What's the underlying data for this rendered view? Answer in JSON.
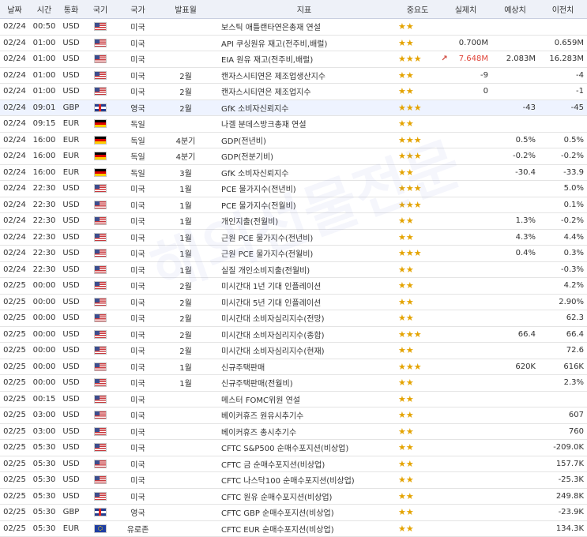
{
  "headers": [
    "날짜",
    "시간",
    "통화",
    "국기",
    "국가",
    "발표월",
    "지표",
    "중요도",
    "실제치",
    "예상치",
    "이전치"
  ],
  "watermark": "해외선물전문",
  "rows": [
    {
      "date": "02/24",
      "time": "00:50",
      "cur": "USD",
      "flag": "us",
      "country": "미국",
      "month": "",
      "name": "보스틱 애틀랜타연은총재 연설",
      "stars": "★★",
      "actual": "",
      "forecast": "",
      "previous": ""
    },
    {
      "date": "02/24",
      "time": "01:00",
      "cur": "USD",
      "flag": "us",
      "country": "미국",
      "month": "",
      "name": "API 쿠싱원유 재고(전주비,배럴)",
      "stars": "★★",
      "actual": "0.700M",
      "forecast": "",
      "previous": "0.659M"
    },
    {
      "date": "02/24",
      "time": "01:00",
      "cur": "USD",
      "flag": "us",
      "country": "미국",
      "month": "",
      "name": "EIA 원유 재고(전주비,배럴)",
      "stars": "★★★",
      "arrow": "↗",
      "actual": "7.648M",
      "actual_red": true,
      "forecast": "2.083M",
      "previous": "16.283M"
    },
    {
      "date": "02/24",
      "time": "01:00",
      "cur": "USD",
      "flag": "us",
      "country": "미국",
      "month": "2월",
      "name": "캔자스시티연은 제조업생산지수",
      "stars": "★★",
      "actual": "-9",
      "forecast": "",
      "previous": "-4"
    },
    {
      "date": "02/24",
      "time": "01:00",
      "cur": "USD",
      "flag": "us",
      "country": "미국",
      "month": "2월",
      "name": "캔자스시티연은 제조업지수",
      "stars": "★★",
      "actual": "0",
      "forecast": "",
      "previous": "-1"
    },
    {
      "date": "02/24",
      "time": "09:01",
      "cur": "GBP",
      "flag": "gb",
      "country": "영국",
      "month": "2월",
      "name": "GfK 소비자신뢰지수",
      "stars": "★★★",
      "actual": "",
      "forecast": "-43",
      "previous": "-45",
      "hl": true
    },
    {
      "date": "02/24",
      "time": "09:15",
      "cur": "EUR",
      "flag": "de",
      "country": "독일",
      "month": "",
      "name": "나겔 분데스방크총재 연설",
      "stars": "★★",
      "actual": "",
      "forecast": "",
      "previous": ""
    },
    {
      "date": "02/24",
      "time": "16:00",
      "cur": "EUR",
      "flag": "de",
      "country": "독일",
      "month": "4분기",
      "name": "GDP(전년비)",
      "stars": "★★★",
      "actual": "",
      "forecast": "0.5%",
      "previous": "0.5%"
    },
    {
      "date": "02/24",
      "time": "16:00",
      "cur": "EUR",
      "flag": "de",
      "country": "독일",
      "month": "4분기",
      "name": "GDP(전분기비)",
      "stars": "★★★",
      "actual": "",
      "forecast": "-0.2%",
      "previous": "-0.2%"
    },
    {
      "date": "02/24",
      "time": "16:00",
      "cur": "EUR",
      "flag": "de",
      "country": "독일",
      "month": "3월",
      "name": "GfK 소비자신뢰지수",
      "stars": "★★",
      "actual": "",
      "forecast": "-30.4",
      "previous": "-33.9"
    },
    {
      "date": "02/24",
      "time": "22:30",
      "cur": "USD",
      "flag": "us",
      "country": "미국",
      "month": "1월",
      "name": "PCE 물가지수(전년비)",
      "stars": "★★★",
      "actual": "",
      "forecast": "",
      "previous": "5.0%"
    },
    {
      "date": "02/24",
      "time": "22:30",
      "cur": "USD",
      "flag": "us",
      "country": "미국",
      "month": "1월",
      "name": "PCE 물가지수(전월비)",
      "stars": "★★★",
      "actual": "",
      "forecast": "",
      "previous": "0.1%"
    },
    {
      "date": "02/24",
      "time": "22:30",
      "cur": "USD",
      "flag": "us",
      "country": "미국",
      "month": "1월",
      "name": "개인지출(전월비)",
      "stars": "★★",
      "actual": "",
      "forecast": "1.3%",
      "previous": "-0.2%"
    },
    {
      "date": "02/24",
      "time": "22:30",
      "cur": "USD",
      "flag": "us",
      "country": "미국",
      "month": "1월",
      "name": "근원 PCE 물가지수(전년비)",
      "stars": "★★",
      "actual": "",
      "forecast": "4.3%",
      "previous": "4.4%"
    },
    {
      "date": "02/24",
      "time": "22:30",
      "cur": "USD",
      "flag": "us",
      "country": "미국",
      "month": "1월",
      "name": "근원 PCE 물가지수(전월비)",
      "stars": "★★★",
      "actual": "",
      "forecast": "0.4%",
      "previous": "0.3%"
    },
    {
      "date": "02/24",
      "time": "22:30",
      "cur": "USD",
      "flag": "us",
      "country": "미국",
      "month": "1월",
      "name": "실질 개인소비지출(전월비)",
      "stars": "★★",
      "actual": "",
      "forecast": "",
      "previous": "-0.3%"
    },
    {
      "date": "02/25",
      "time": "00:00",
      "cur": "USD",
      "flag": "us",
      "country": "미국",
      "month": "2월",
      "name": "미시간대 1년 기대 인플레이션",
      "stars": "★★",
      "actual": "",
      "forecast": "",
      "previous": "4.2%"
    },
    {
      "date": "02/25",
      "time": "00:00",
      "cur": "USD",
      "flag": "us",
      "country": "미국",
      "month": "2월",
      "name": "미시간대 5년 기대 인플레이션",
      "stars": "★★",
      "actual": "",
      "forecast": "",
      "previous": "2.90%"
    },
    {
      "date": "02/25",
      "time": "00:00",
      "cur": "USD",
      "flag": "us",
      "country": "미국",
      "month": "2월",
      "name": "미시간대 소비자심리지수(전망)",
      "stars": "★★",
      "actual": "",
      "forecast": "",
      "previous": "62.3"
    },
    {
      "date": "02/25",
      "time": "00:00",
      "cur": "USD",
      "flag": "us",
      "country": "미국",
      "month": "2월",
      "name": "미시간대 소비자심리지수(종합)",
      "stars": "★★★",
      "actual": "",
      "forecast": "66.4",
      "previous": "66.4"
    },
    {
      "date": "02/25",
      "time": "00:00",
      "cur": "USD",
      "flag": "us",
      "country": "미국",
      "month": "2월",
      "name": "미시간대 소비자심리지수(현재)",
      "stars": "★★",
      "actual": "",
      "forecast": "",
      "previous": "72.6"
    },
    {
      "date": "02/25",
      "time": "00:00",
      "cur": "USD",
      "flag": "us",
      "country": "미국",
      "month": "1월",
      "name": "신규주택판매",
      "stars": "★★★",
      "actual": "",
      "forecast": "620K",
      "previous": "616K"
    },
    {
      "date": "02/25",
      "time": "00:00",
      "cur": "USD",
      "flag": "us",
      "country": "미국",
      "month": "1월",
      "name": "신규주택판매(전월비)",
      "stars": "★★",
      "actual": "",
      "forecast": "",
      "previous": "2.3%"
    },
    {
      "date": "02/25",
      "time": "00:15",
      "cur": "USD",
      "flag": "us",
      "country": "미국",
      "month": "",
      "name": "메스터 FOMC위원 연설",
      "stars": "★★",
      "actual": "",
      "forecast": "",
      "previous": ""
    },
    {
      "date": "02/25",
      "time": "03:00",
      "cur": "USD",
      "flag": "us",
      "country": "미국",
      "month": "",
      "name": "베이커휴즈 원유시추기수",
      "stars": "★★",
      "actual": "",
      "forecast": "",
      "previous": "607"
    },
    {
      "date": "02/25",
      "time": "03:00",
      "cur": "USD",
      "flag": "us",
      "country": "미국",
      "month": "",
      "name": "베이커휴즈 총시추기수",
      "stars": "★★",
      "actual": "",
      "forecast": "",
      "previous": "760"
    },
    {
      "date": "02/25",
      "time": "05:30",
      "cur": "USD",
      "flag": "us",
      "country": "미국",
      "month": "",
      "name": "CFTC S&P500 순매수포지션(비상업)",
      "stars": "★★",
      "actual": "",
      "forecast": "",
      "previous": "-209.0K"
    },
    {
      "date": "02/25",
      "time": "05:30",
      "cur": "USD",
      "flag": "us",
      "country": "미국",
      "month": "",
      "name": "CFTC 금 순매수포지션(비상업)",
      "stars": "★★",
      "actual": "",
      "forecast": "",
      "previous": "157.7K"
    },
    {
      "date": "02/25",
      "time": "05:30",
      "cur": "USD",
      "flag": "us",
      "country": "미국",
      "month": "",
      "name": "CFTC 나스닥100 순매수포지션(비상업)",
      "stars": "★★",
      "actual": "",
      "forecast": "",
      "previous": "-25.3K"
    },
    {
      "date": "02/25",
      "time": "05:30",
      "cur": "USD",
      "flag": "us",
      "country": "미국",
      "month": "",
      "name": "CFTC 원유 순매수포지션(비상업)",
      "stars": "★★",
      "actual": "",
      "forecast": "",
      "previous": "249.8K"
    },
    {
      "date": "02/25",
      "time": "05:30",
      "cur": "GBP",
      "flag": "gb",
      "country": "영국",
      "month": "",
      "name": "CFTC GBP 순매수포지션(비상업)",
      "stars": "★★",
      "actual": "",
      "forecast": "",
      "previous": "-23.9K"
    },
    {
      "date": "02/25",
      "time": "05:30",
      "cur": "EUR",
      "flag": "eu",
      "country": "유로존",
      "month": "",
      "name": "CFTC EUR 순매수포지션(비상업)",
      "stars": "★★",
      "actual": "",
      "forecast": "",
      "previous": "134.3K"
    }
  ]
}
